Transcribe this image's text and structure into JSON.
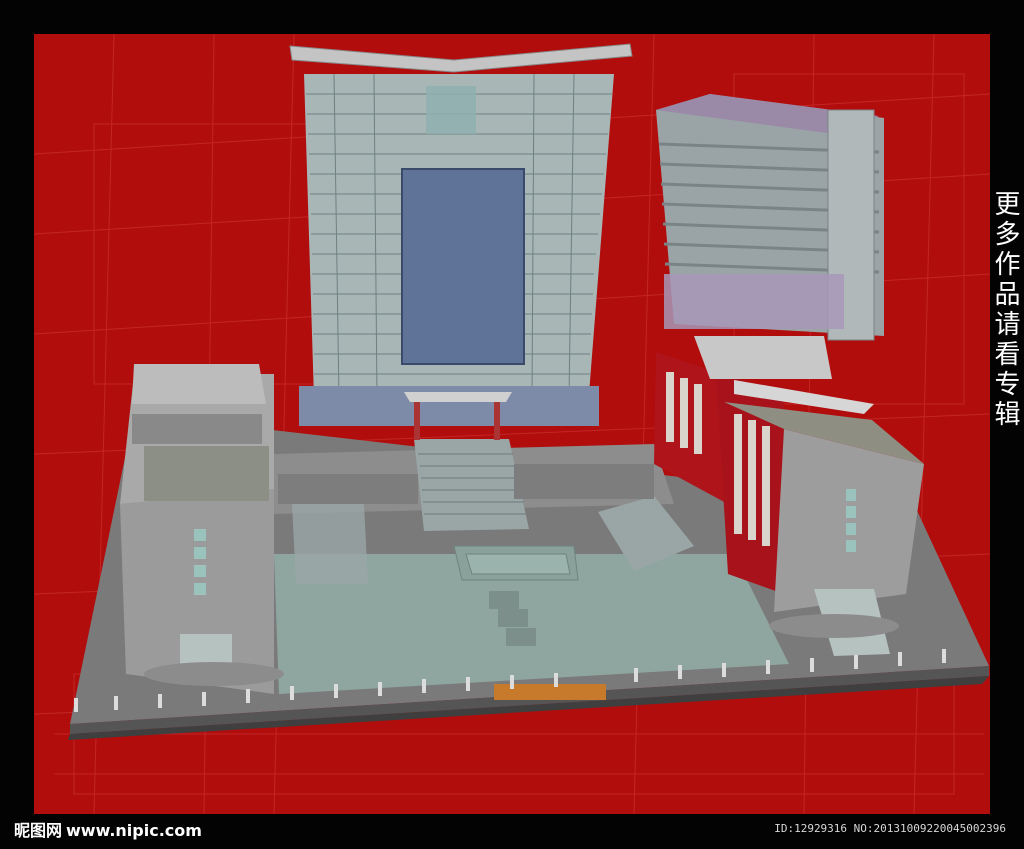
{
  "side_caption": "更多作品请看专辑",
  "watermark": {
    "brand": "昵图网",
    "site": "www.nipic.com"
  },
  "image_id_text": "ID:12929316 NO:20131009220045002396",
  "scene": {
    "subject": "3D architectural model of an office complex with plaza",
    "colors": {
      "background_red": "#b10d0d",
      "frame_black": "#030303",
      "plaza_teal": "#8fa6a0",
      "wall_grey": "#9b9b9b",
      "glass_blue": "#5f7398",
      "brick_red": "#b0141b",
      "roof_purple": "#9a8aa8"
    }
  }
}
